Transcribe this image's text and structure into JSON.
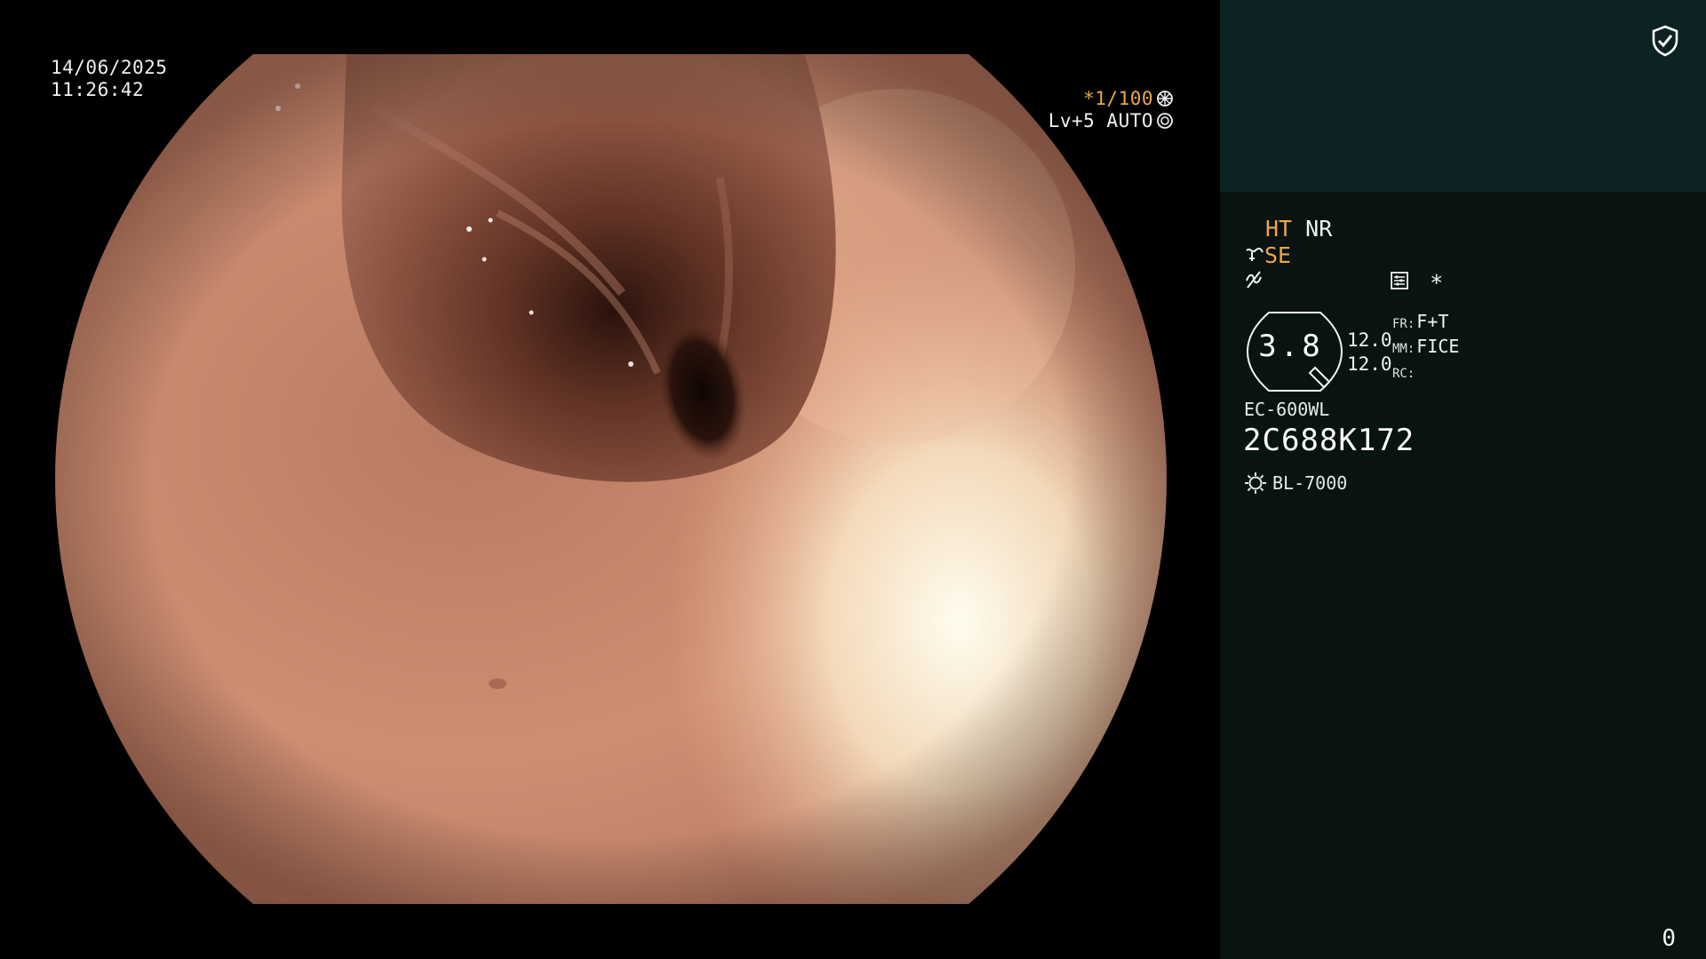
{
  "overlay": {
    "date": "14/06/2025",
    "time": "11:26:42",
    "shutter_speed": "*1/100",
    "iris_level": "Lv+5",
    "iris_mode": "AUTO",
    "shutter_icon": "aperture-icon",
    "iris_icon": "iris-icon"
  },
  "panel": {
    "security_icon": "shield-check-icon",
    "ht": "HT",
    "nr": "NR",
    "se": "SE",
    "structure_icon": "structure-enhance-icon",
    "color_icon": "color-enhance-icon",
    "list_icon": "settings-list-icon",
    "star": "*",
    "zoom_value": "3.8",
    "zoom_a": "12.0",
    "zoom_b": "12.0",
    "fr_label": "FR:",
    "fr_value": "F+T",
    "mm_label": "MM:",
    "mm_value": "FICE",
    "rc_label": "RC:",
    "rc_value": "",
    "scope_model": "EC-600WL",
    "scope_serial": "2C688K172",
    "light_source_icon": "light-source-icon",
    "light_source": "BL-7000",
    "frame_counter": "0"
  },
  "colors": {
    "accent_orange": "#f0a54a",
    "panel_bg": "#081312",
    "panel_header_bg": "#0c2223",
    "tissue": "#d9987a"
  }
}
